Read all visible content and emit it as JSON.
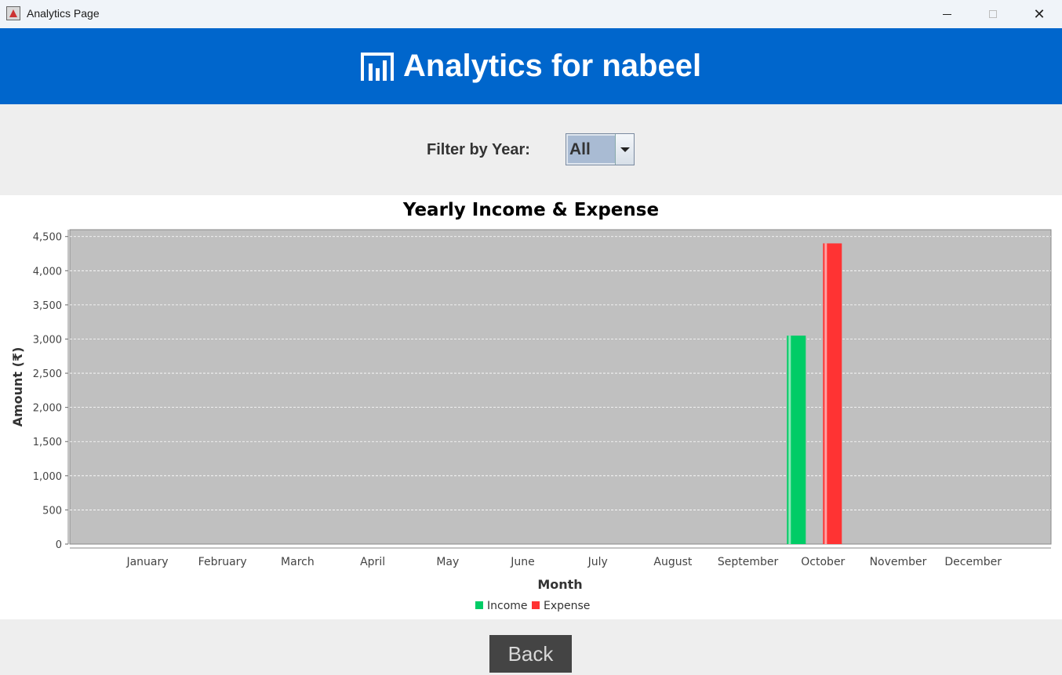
{
  "window": {
    "title": "Analytics Page",
    "close_glyph": "✕"
  },
  "header": {
    "title": "Analytics for nabeel",
    "icon": "bar-chart-icon",
    "background": "#0066cc"
  },
  "filter": {
    "label": "Filter by Year:",
    "selected": "All"
  },
  "chart_data": {
    "type": "bar",
    "title": "Yearly Income & Expense",
    "xlabel": "Month",
    "ylabel": "Amount (₹)",
    "categories": [
      "January",
      "February",
      "March",
      "April",
      "May",
      "June",
      "July",
      "August",
      "September",
      "October",
      "November",
      "December"
    ],
    "series": [
      {
        "name": "Income",
        "color": "#00cc66",
        "values": [
          0,
          0,
          0,
          0,
          0,
          0,
          0,
          0,
          0,
          3050,
          0,
          0
        ]
      },
      {
        "name": "Expense",
        "color": "#ff3333",
        "values": [
          0,
          0,
          0,
          0,
          0,
          0,
          0,
          0,
          0,
          4400,
          0,
          0
        ]
      }
    ],
    "ylim": [
      0,
      4600
    ],
    "yticks": [
      0,
      500,
      1000,
      1500,
      2000,
      2500,
      3000,
      3500,
      4000,
      4500
    ],
    "ytick_labels": [
      "0",
      "500",
      "1,000",
      "1,500",
      "2,000",
      "2,500",
      "3,000",
      "3,500",
      "4,000",
      "4,500"
    ],
    "grid": true,
    "legend": "bottom-center",
    "plot_background": "#c0c0c0"
  },
  "footer": {
    "back_label": "Back"
  }
}
